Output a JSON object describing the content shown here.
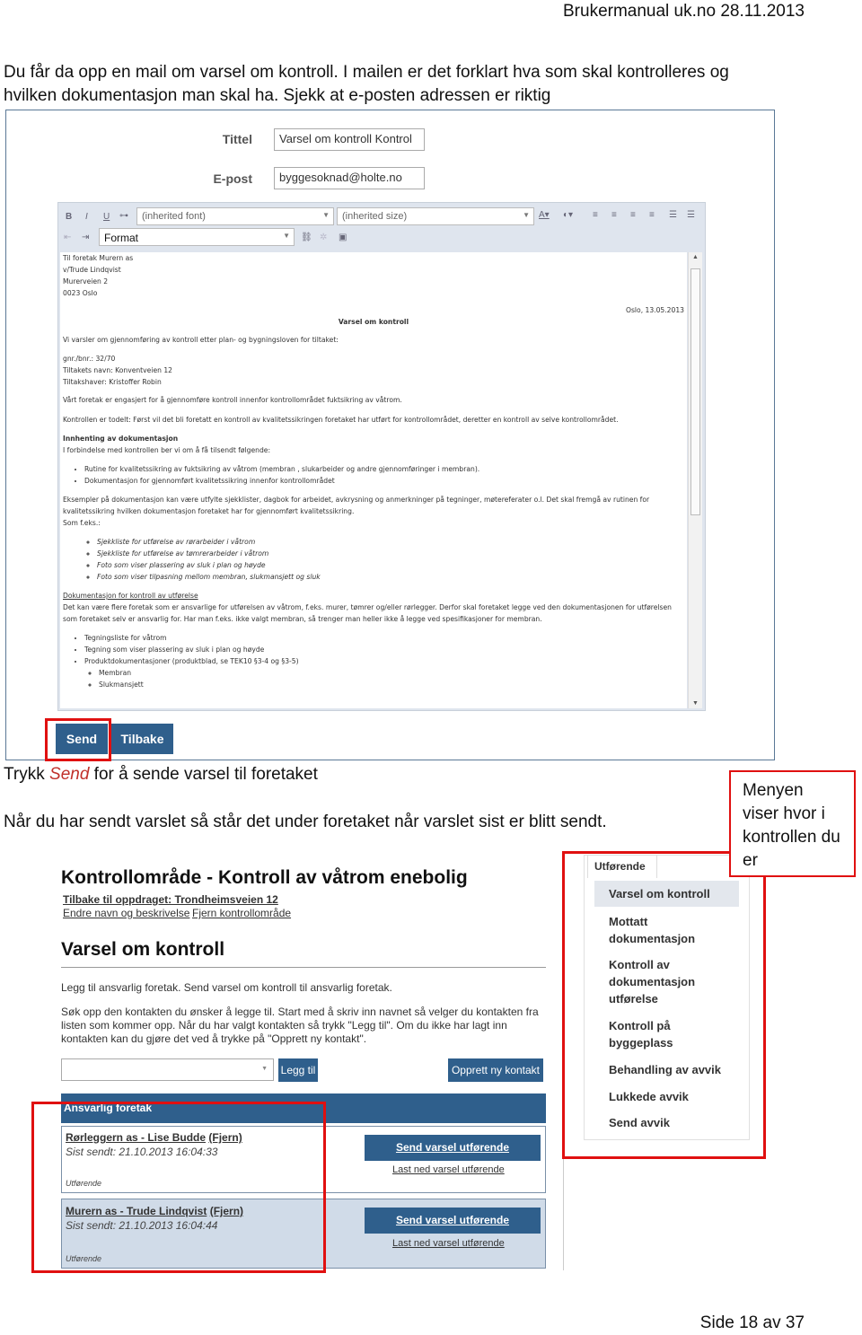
{
  "header": "Brukermanual uk.no 28.11.2013",
  "intro": [
    "Du får da opp en mail om varsel om kontroll. I mailen er det forklart hva som skal kontrolleres og",
    "hvilken dokumentasjon man skal ha. Sjekk at e-posten adressen er riktig"
  ],
  "form": {
    "title_label": "Tittel",
    "title_value": "Varsel om kontroll Kontrol",
    "email_label": "E-post",
    "email_value": "byggesoknad@holte.no"
  },
  "toolbar": {
    "bold": "B",
    "italic": "I",
    "underline": "U",
    "font": "(inherited font)",
    "size": "(inherited size)",
    "format": "Format"
  },
  "email": {
    "address": [
      "Til foretak Murern as",
      "v/Trude Lindqvist",
      "Murerveien 2",
      "0023 Oslo"
    ],
    "date": "Oslo, 13.05.2013",
    "heading": "Varsel om kontroll",
    "p1": "Vi varsler om gjennomføring av kontroll etter plan- og bygningsloven for tiltaket:",
    "info": [
      "gnr./bnr.: 32/70",
      "Tiltakets navn: Konventveien 12",
      "Tiltakshaver: Kristoffer Robin"
    ],
    "p2": "Vårt foretak er engasjert for å gjennomføre kontroll innenfor kontrollområdet fuktsikring av våtrom.",
    "p3": "Kontrollen er todelt: Først vil det bli foretatt en kontroll av kvalitetssikringen foretaket har utført for kontrollområdet, deretter en kontroll av selve kontrollområdet.",
    "h2": "Innhenting av dokumentasjon",
    "p4": "I forbindelse med kontrollen ber vi om å få tilsendt følgende:",
    "list1": [
      "Rutine for kvalitetssikring av fuktsikring av våtrom (membran , slukarbeider og andre gjennomføringer i membran).",
      "Dokumentasjon for gjennomført kvalitetssikring innenfor kontrollområdet"
    ],
    "p5": "Eksempler på dokumentasjon kan være utfylte sjekklister, dagbok for arbeidet, avkrysning og anmerkninger på tegninger, møtereferater o.l. Det skal fremgå av rutinen for kvalitetssikring hvilken dokumentasjon foretaket har for gjennomført kvalitetssikring.",
    "p6": "Som f.eks.:",
    "list2": [
      "Sjekkliste for utførelse av rørarbeider i våtrom",
      "Sjekkliste for utførelse av tømrerarbeider i våtrom",
      "Foto som viser plassering av sluk i plan og høyde",
      "Foto som viser tilpasning mellom membran, slukmansjett og sluk"
    ],
    "h3": "Dokumentasjon for kontroll av utførelse",
    "p7": "Det kan være flere foretak som er ansvarlige for utførelsen av våtrom, f.eks. murer, tømrer og/eller rørlegger. Derfor skal foretaket legge ved den dokumentasjonen for utførelsen som foretaket selv er ansvarlig for. Har man f.eks. ikke valgt membran, så trenger man heller ikke å legge ved spesifikasjoner for membran.",
    "list3": [
      "Tegningsliste for våtrom",
      "Tegning som viser plassering av sluk i plan og høyde",
      "Produktdokumentasjoner (produktblad, se TEK10 §3-4 og §3-5)"
    ],
    "list4": [
      "Membran",
      "Slukmansjett"
    ]
  },
  "buttons": {
    "send": "Send",
    "back": "Tilbake"
  },
  "text2": {
    "pre": "Trykk ",
    "em": "Send",
    "post": " for å sende varsel til foretaket"
  },
  "text3": "Når du har sendt varslet så står det under foretaket når varslet sist er blitt sendt.",
  "callout": "Menyen viser hvor i kontrollen du er",
  "page2": {
    "title": "Kontrollområde - Kontroll av våtrom enebolig",
    "back_link": "Tilbake til oppdraget: Trondheimsveien 12",
    "edit_link": "Endre navn og beskrivelse",
    "remove_link": "Fjern kontrollområde",
    "h2": "Varsel om kontroll",
    "p1": "Legg til ansvarlig foretak. Send varsel om kontroll til ansvarlig foretak.",
    "p2": "Søk opp den kontakten du ønsker å legge til. Start med å skriv inn navnet så velger du kontakten fra listen som kommer opp. Når du har valgt kontakten så trykk \"Legg til\". Om du ikke har lagt inn kontakten kan du gjøre det ved å trykke på \"Opprett ny kontakt\".",
    "add_btn": "Legg til",
    "new_btn": "Opprett ny kontakt",
    "table_header": "Ansvarlig foretak",
    "rows": [
      {
        "name": "Rørleggern as - Lise Budde",
        "remove": "(Fjern)",
        "sent": "Sist sendt: 21.10.2013 16:04:33",
        "role": "Utførende",
        "send": "Send varsel utførende",
        "download": "Last ned varsel utførende"
      },
      {
        "name": "Murern as - Trude Lindqvist",
        "remove": "(Fjern)",
        "sent": "Sist sendt: 21.10.2013 16:04:44",
        "role": "Utførende",
        "send": "Send varsel utførende",
        "download": "Last ned varsel utførende"
      }
    ]
  },
  "menu": {
    "tab": "Utførende",
    "items": [
      "Varsel om kontroll",
      "Mottatt dokumentasjon",
      "Kontroll av dokumentasjon utførelse",
      "Kontroll på byggeplass",
      "Behandling av avvik",
      "Lukkede avvik",
      "Send avvik"
    ],
    "active": 0
  },
  "footer": "Side 18 av 37",
  "colors": {
    "accent": "#2f5f8c",
    "highlight": "#e01010"
  }
}
